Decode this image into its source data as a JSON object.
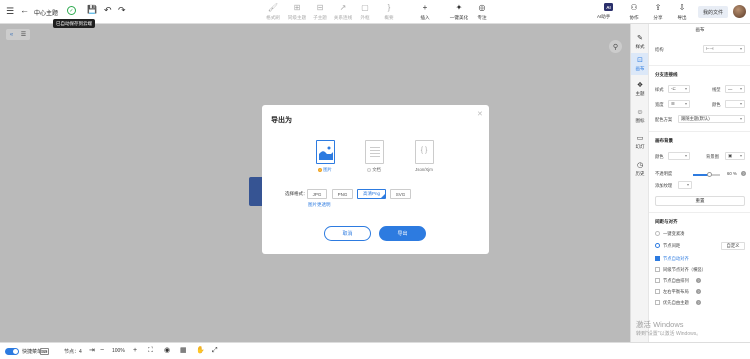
{
  "topbar": {
    "title": "中心主题",
    "tooltip": "已自动保存到云端",
    "tools": [
      {
        "icon": "format-painter-icon",
        "glyph": "🖌",
        "label": "格式刷"
      },
      {
        "icon": "sibling-topic-icon",
        "glyph": "⊞",
        "label": "同级主题"
      },
      {
        "icon": "child-topic-icon",
        "glyph": "⊟",
        "label": "子主题"
      },
      {
        "icon": "relation-icon",
        "glyph": "↗",
        "label": "关系连线"
      },
      {
        "icon": "outer-frame-icon",
        "glyph": "▢",
        "label": "外框"
      },
      {
        "icon": "summary-icon",
        "glyph": "}",
        "label": "概要"
      },
      {
        "icon": "insert-icon",
        "glyph": "+",
        "label": "插入"
      },
      {
        "icon": "beautify-icon",
        "glyph": "✦",
        "label": "一键美化"
      },
      {
        "icon": "focus-icon",
        "glyph": "◎",
        "label": "专注"
      }
    ],
    "ai_badge": "AI",
    "ai_label": "AI助手",
    "right_actions": [
      {
        "icon": "collaborate-icon",
        "glyph": "⚇",
        "label": "协作"
      },
      {
        "icon": "share-icon",
        "glyph": "⇪",
        "label": "分享"
      },
      {
        "icon": "export-icon",
        "glyph": "⇩",
        "label": "导出"
      }
    ],
    "my_files": "我的文件"
  },
  "modal": {
    "title": "导出为",
    "formats": [
      {
        "label": "图片",
        "active": true
      },
      {
        "label": "文档",
        "active": false
      },
      {
        "label": "Json/Xjm",
        "active": false
      }
    ],
    "choose_format_label": "选择格式：",
    "options": [
      {
        "label": "JPG",
        "selected": false
      },
      {
        "label": "PNG",
        "selected": false
      },
      {
        "label": "高清Png",
        "selected": true
      },
      {
        "label": "SVG",
        "selected": false
      }
    ],
    "transparent_link": "图片更透明",
    "cancel": "取消",
    "confirm": "导出"
  },
  "side_tabs": [
    {
      "icon": "style-icon",
      "glyph": "✎",
      "label": "样式",
      "active": false
    },
    {
      "icon": "canvas-icon",
      "glyph": "⊡",
      "label": "画布",
      "active": true
    },
    {
      "icon": "theme-icon",
      "glyph": "❖",
      "label": "主题",
      "active": false
    },
    {
      "icon": "icon-library-icon",
      "glyph": "☺",
      "label": "图标",
      "active": false
    },
    {
      "icon": "slides-icon",
      "glyph": "▭",
      "label": "幻灯",
      "active": false
    },
    {
      "icon": "history-icon",
      "glyph": "◷",
      "label": "历史",
      "active": false
    }
  ],
  "panel": {
    "title": "画布",
    "structure_label": "结构",
    "branch_section": "分支连接线",
    "style_label": "样式",
    "line_type_label": "线型",
    "width_label": "宽度",
    "color_label": "颜色",
    "color_scheme_label": "配色方案",
    "color_scheme_value": "跟随主题(默认)",
    "bg_section": "画布背景",
    "bg_color_label": "颜色",
    "bg_image_label": "背景图",
    "opacity_label": "不透明度",
    "opacity_value": "60",
    "opacity_unit": "%",
    "opacity_fraction": 0.6,
    "add_texture_label": "添加纹理",
    "reset_label": "重置",
    "layout_section": "间距与对齐",
    "one_click_label": "一键变紧凑",
    "node_spacing_label": "节点间距",
    "custom_label": "自定义",
    "checks": [
      {
        "label": "节点自动对齐",
        "on": true
      },
      {
        "label": "同级节点对齐（横竖）",
        "on": false
      },
      {
        "label": "节点自由排列",
        "on": false
      },
      {
        "label": "左右平衡布局",
        "on": false
      },
      {
        "label": "优先自由主题",
        "on": false
      }
    ]
  },
  "watermark": {
    "line1": "激活 Windows",
    "line2": "转到\"设置\"以激活 Windows。"
  },
  "bottombar": {
    "quick_edit": "快捷菜单",
    "node_count_label": "节点：",
    "node_count": "4",
    "zoom": "100%"
  }
}
